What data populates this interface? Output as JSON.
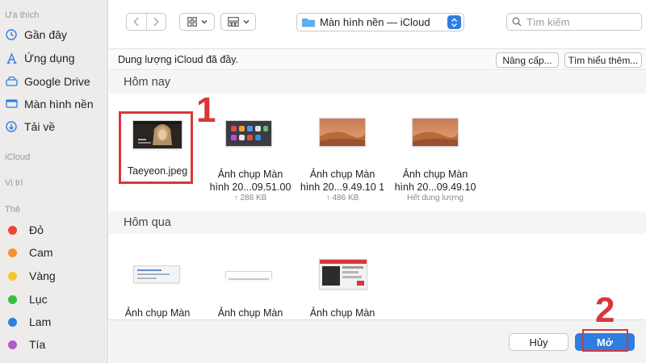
{
  "sidebar": {
    "favorites_header": "Ưa thích",
    "favorites": [
      {
        "label": "Gần đây",
        "icon": "clock-icon"
      },
      {
        "label": "Ứng dụng",
        "icon": "apps-icon"
      },
      {
        "label": "Google Drive",
        "icon": "drive-icon"
      },
      {
        "label": "Màn hình nền",
        "icon": "desktop-icon"
      },
      {
        "label": "Tải về",
        "icon": "download-icon"
      }
    ],
    "icloud_header": "iCloud",
    "locations_header": "Vị trí",
    "tags_header": "Thẻ",
    "tags": [
      {
        "label": "Đỏ",
        "color": "#f0453a"
      },
      {
        "label": "Cam",
        "color": "#f5922f"
      },
      {
        "label": "Vàng",
        "color": "#f5c626"
      },
      {
        "label": "Lục",
        "color": "#3dbb3d"
      },
      {
        "label": "Lam",
        "color": "#2f7de1"
      },
      {
        "label": "Tía",
        "color": "#b05ec9"
      }
    ]
  },
  "toolbar": {
    "location": "Màn hình nền — iCloud",
    "search_placeholder": "Tìm kiếm",
    "accent": "#2f7de1"
  },
  "infobar": {
    "message": "Dung lượng iCloud đã đầy.",
    "upgrade_label": "Nâng cấp...",
    "learn_label": "Tìm hiểu thêm..."
  },
  "today": {
    "header": "Hôm nay",
    "files": [
      {
        "name1": "Taeyeon.jpeg",
        "name2": "",
        "size": ""
      },
      {
        "name1": "Ảnh chụp Màn",
        "name2": "hình 20...09.51.00",
        "size": "↑ 288 KB"
      },
      {
        "name1": "Ảnh chụp Màn",
        "name2": "hình 20...9.49.10 1",
        "size": "↑ 486 KB"
      },
      {
        "name1": "Ảnh chụp Màn",
        "name2": "hình 20...09.49.10",
        "size": "Hết dung lượng"
      }
    ]
  },
  "yesterday": {
    "header": "Hôm qua",
    "files": [
      {
        "name1": "Ảnh chụp Màn"
      },
      {
        "name1": "Ảnh chụp Màn"
      },
      {
        "name1": "Ảnh chụp Màn"
      }
    ]
  },
  "annotations": {
    "step1": "1",
    "step2": "2",
    "highlight_color": "#d8373a"
  },
  "buttons": {
    "cancel": "Hủy",
    "open": "Mở"
  }
}
